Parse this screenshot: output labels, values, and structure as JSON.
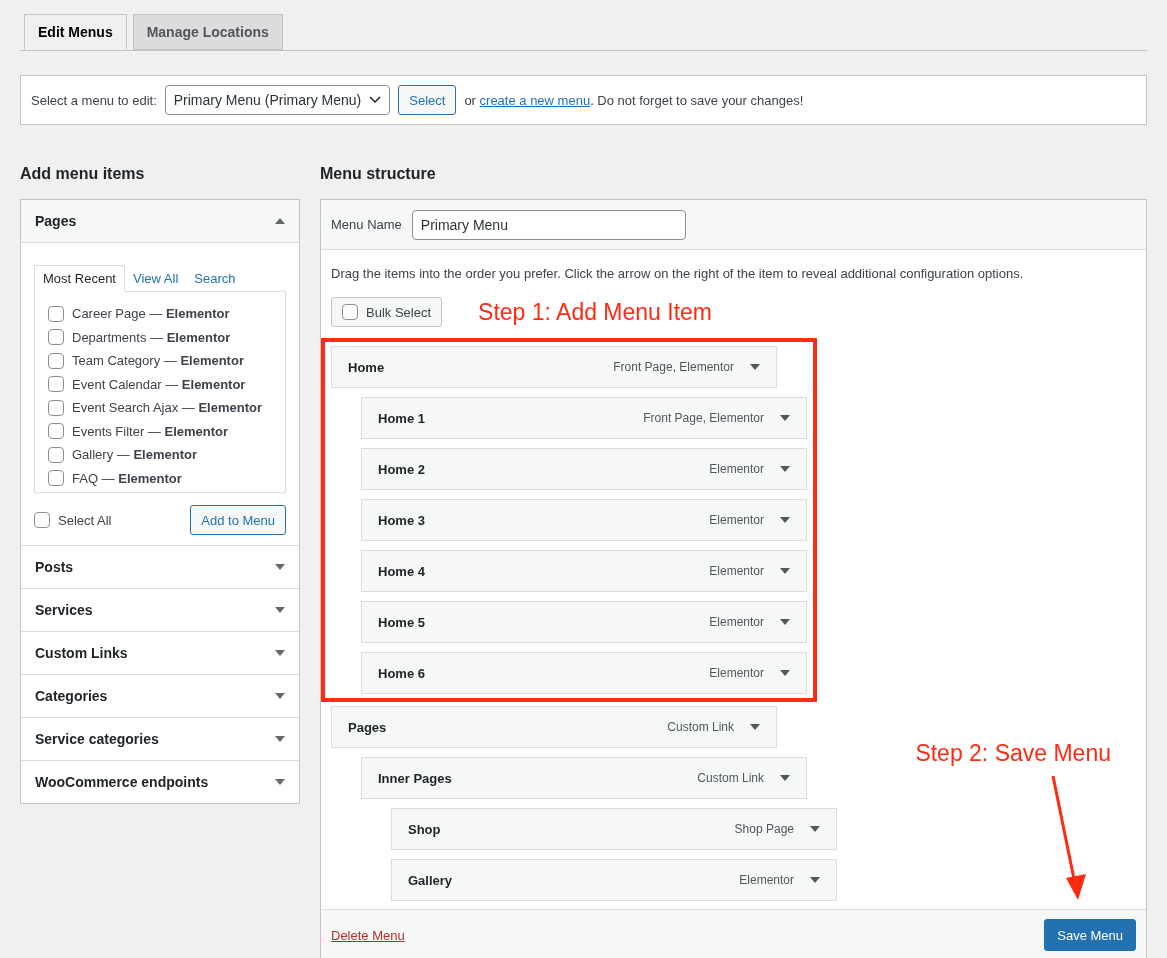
{
  "tabs": [
    {
      "label": "Edit Menus",
      "selected": true
    },
    {
      "label": "Manage Locations",
      "selected": false
    }
  ],
  "menu_select": {
    "label": "Select a menu to edit:",
    "value": "Primary Menu (Primary Menu)",
    "button": "Select",
    "text_before_link": "or",
    "link": "create a new menu",
    "text_after_link": ". Do not forget to save your changes!"
  },
  "add_items": {
    "title": "Add menu items",
    "sections": [
      {
        "title": "Pages",
        "expanded": true,
        "tabs": [
          {
            "label": "Most Recent",
            "selected": true
          },
          {
            "label": "View All",
            "selected": false
          },
          {
            "label": "Search",
            "selected": false
          }
        ],
        "items": [
          {
            "label": "Career Page — **Elementor**",
            "checked": false
          },
          {
            "label": "Departments — **Elementor**",
            "checked": false
          },
          {
            "label": "Team Category — **Elementor**",
            "checked": false
          },
          {
            "label": "Event Calendar — **Elementor**",
            "checked": false
          },
          {
            "label": "Event Search Ajax — **Elementor**",
            "checked": false
          },
          {
            "label": "Events Filter — **Elementor**",
            "checked": false
          },
          {
            "label": "Gallery — **Elementor**",
            "checked": false
          },
          {
            "label": "FAQ — **Elementor**",
            "checked": false
          }
        ],
        "select_all": {
          "label": "Select All",
          "checked": false
        },
        "add_button": "Add to Menu"
      },
      {
        "title": "Posts",
        "expanded": false
      },
      {
        "title": "Services",
        "expanded": false
      },
      {
        "title": "Custom Links",
        "expanded": false
      },
      {
        "title": "Categories",
        "expanded": false
      },
      {
        "title": "Service categories",
        "expanded": false
      },
      {
        "title": "WooCommerce endpoints",
        "expanded": false
      }
    ]
  },
  "menu_structure": {
    "title": "Menu structure",
    "name_label": "Menu Name",
    "name_value": "Primary Menu",
    "instructions": "Drag the items into the order you prefer. Click the arrow on the right of the item to reveal additional configuration options.",
    "bulk_select": {
      "label": "Bulk Select",
      "checked": false
    },
    "items": [
      {
        "title": "Home",
        "type": "Front Page, Elementor",
        "highlighted": true,
        "children": [
          {
            "title": "Home 1",
            "type": "Front Page, Elementor"
          },
          {
            "title": "Home 2",
            "type": "Elementor"
          },
          {
            "title": "Home 3",
            "type": "Elementor"
          },
          {
            "title": "Home 4",
            "type": "Elementor"
          },
          {
            "title": "Home 5",
            "type": "Elementor"
          },
          {
            "title": "Home 6",
            "type": "Elementor"
          }
        ]
      },
      {
        "title": "Pages",
        "type": "Custom Link",
        "highlighted": false,
        "children": [
          {
            "title": "Inner Pages",
            "type": "Custom Link",
            "children": [
              {
                "title": "Shop",
                "type": "Shop Page"
              },
              {
                "title": "Gallery",
                "type": "Elementor"
              }
            ]
          }
        ]
      }
    ],
    "delete_link": "Delete Menu",
    "save_button": "Save Menu"
  },
  "annotations": [
    {
      "text": "Step 1: Add Menu Item"
    },
    {
      "text": "Step 2: Save Menu"
    }
  ]
}
